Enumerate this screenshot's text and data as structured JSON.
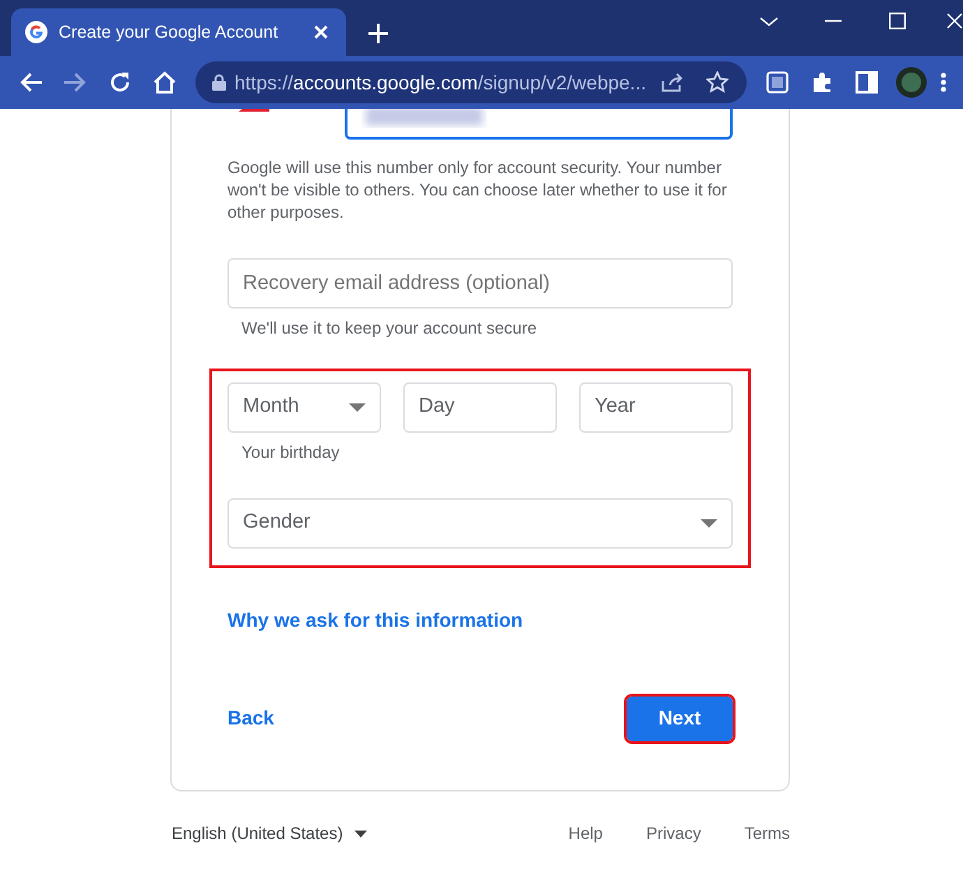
{
  "browser": {
    "tab_title": "Create your Google Account",
    "url": {
      "scheme": "https://",
      "host": "accounts.google.com",
      "path": "/signup/v2/webpe..."
    }
  },
  "form": {
    "phone": {
      "focused": true
    },
    "phone_note": "Google will use this number only for account security. Your number won't be visible to others. You can choose later whether to use it for other purposes.",
    "recovery_email": {
      "placeholder": "Recovery email address (optional)"
    },
    "recovery_hint": "We'll use it to keep your account secure",
    "birthday": [
      {
        "kind": "select",
        "placeholder": "Month"
      },
      {
        "kind": "text",
        "placeholder": "Day"
      },
      {
        "kind": "text",
        "placeholder": "Year"
      }
    ],
    "birthday_hint": "Your birthday",
    "gender": {
      "kind": "select",
      "placeholder": "Gender"
    },
    "highlighted": true,
    "info_link": "Why we ask for this information",
    "back": "Back",
    "next": {
      "label": "Next",
      "highlighted": true
    }
  },
  "footer": {
    "language": "English (United States)",
    "links": [
      "Help",
      "Privacy",
      "Terms"
    ]
  }
}
